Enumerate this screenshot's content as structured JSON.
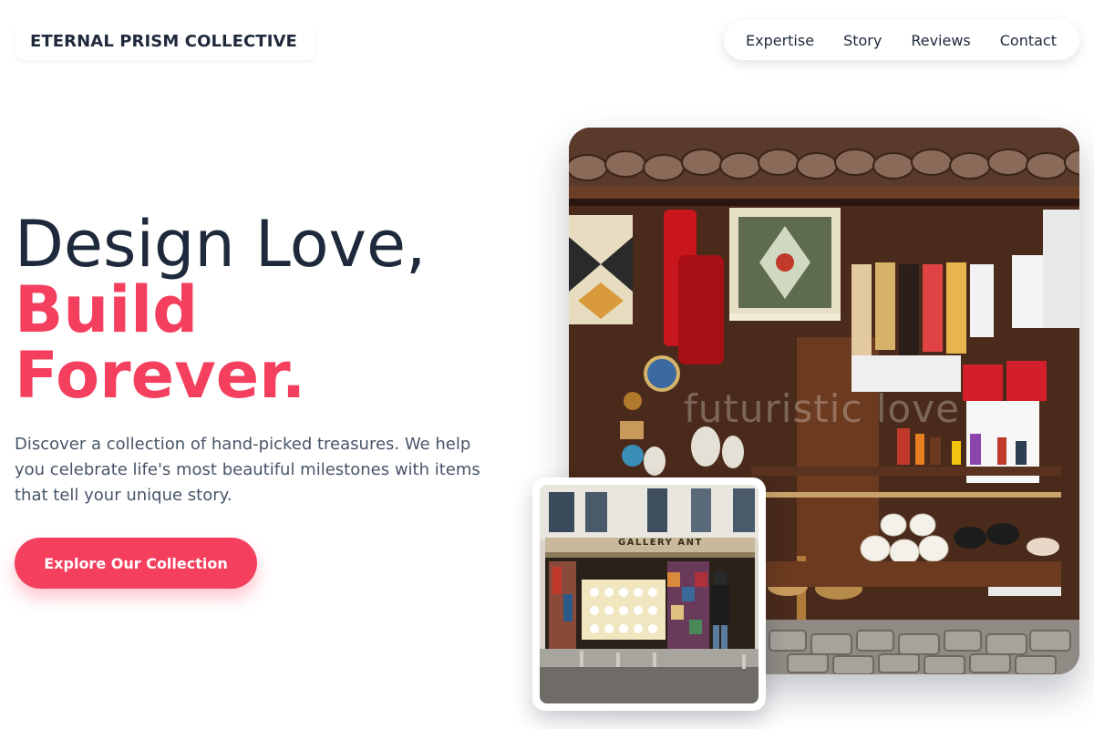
{
  "brand": {
    "name": "ETERNAL PRISM COLLECTIVE"
  },
  "nav": {
    "items": [
      {
        "label": "Expertise"
      },
      {
        "label": "Story"
      },
      {
        "label": "Reviews"
      },
      {
        "label": "Contact"
      }
    ]
  },
  "hero": {
    "headline_line1": "Design Love,",
    "headline_line2": "Build",
    "headline_line3": "Forever.",
    "description": "Discover a collection of hand-picked treasures. We help you celebrate life's most beautiful milestones with items that tell your unique story.",
    "cta_label": "Explore Our Collection"
  },
  "images": {
    "main_watermark": "futuristic love",
    "inset_sign": "GALLERY ANT"
  },
  "colors": {
    "accent": "#f43f5e",
    "heading": "#1e293b",
    "body_text": "#475569"
  }
}
